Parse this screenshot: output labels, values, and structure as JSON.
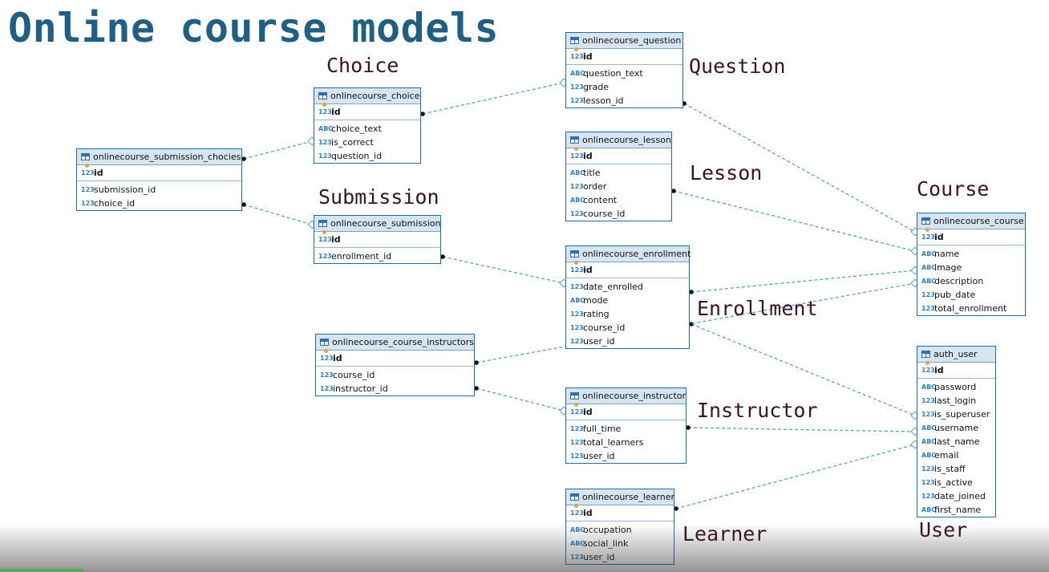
{
  "title": "Online course models",
  "model_labels": {
    "choice": "Choice",
    "question": "Question",
    "lesson": "Lesson",
    "course": "Course",
    "submission": "Submission",
    "enrollment": "Enrollment",
    "instructor": "Instructor",
    "learner": "Learner",
    "user": "User"
  },
  "type_icons": {
    "numeric": "123",
    "text": "ABC"
  },
  "colors": {
    "title": "#1f5f86",
    "entity_border": "#1e6ea2",
    "link": "#5a9fd0",
    "model_label": "#3b1420"
  },
  "entities": {
    "question": {
      "name": "onlinecourse_question",
      "pk": "id",
      "fields": [
        {
          "type": "ABC",
          "name": "question_text"
        },
        {
          "type": "123",
          "name": "grade"
        },
        {
          "type": "123",
          "name": "lesson_id"
        }
      ]
    },
    "choice": {
      "name": "onlinecourse_choice",
      "pk": "id",
      "fields": [
        {
          "type": "ABC",
          "name": "choice_text"
        },
        {
          "type": "123",
          "name": "is_correct"
        },
        {
          "type": "123",
          "name": "question_id"
        }
      ]
    },
    "submission_choices": {
      "name": "onlinecourse_submission_chocies",
      "pk": "id",
      "fields": [
        {
          "type": "123",
          "name": "submission_id"
        },
        {
          "type": "123",
          "name": "choice_id"
        }
      ]
    },
    "lesson": {
      "name": "onlinecourse_lesson",
      "pk": "id",
      "fields": [
        {
          "type": "ABC",
          "name": "title"
        },
        {
          "type": "123",
          "name": "order"
        },
        {
          "type": "ABC",
          "name": "content"
        },
        {
          "type": "123",
          "name": "course_id"
        }
      ]
    },
    "submission": {
      "name": "onlinecourse_submission",
      "pk": "id",
      "fields": [
        {
          "type": "123",
          "name": "enrollment_id"
        }
      ]
    },
    "enrollment": {
      "name": "onlinecourse_enrollment",
      "pk": "id",
      "fields": [
        {
          "type": "123",
          "name": "date_enrolled"
        },
        {
          "type": "ABC",
          "name": "mode"
        },
        {
          "type": "123",
          "name": "rating"
        },
        {
          "type": "123",
          "name": "course_id"
        },
        {
          "type": "123",
          "name": "user_id"
        }
      ]
    },
    "course": {
      "name": "onlinecourse_course",
      "pk": "id",
      "fields": [
        {
          "type": "ABC",
          "name": "name"
        },
        {
          "type": "ABC",
          "name": "image"
        },
        {
          "type": "ABC",
          "name": "description"
        },
        {
          "type": "123",
          "name": "pub_date"
        },
        {
          "type": "123",
          "name": "total_enrollment"
        }
      ]
    },
    "course_instructors": {
      "name": "onlinecourse_course_instructors",
      "pk": "id",
      "fields": [
        {
          "type": "123",
          "name": "course_id"
        },
        {
          "type": "123",
          "name": "instructor_id"
        }
      ]
    },
    "instructor": {
      "name": "onlinecourse_instructor",
      "pk": "id",
      "fields": [
        {
          "type": "123",
          "name": "full_time"
        },
        {
          "type": "123",
          "name": "total_learners"
        },
        {
          "type": "123",
          "name": "user_id"
        }
      ]
    },
    "learner": {
      "name": "onlinecourse_learner",
      "pk": "id",
      "fields": [
        {
          "type": "ABC",
          "name": "occupation"
        },
        {
          "type": "ABC",
          "name": "social_link"
        },
        {
          "type": "123",
          "name": "user_id"
        }
      ]
    },
    "auth_user": {
      "name": "auth_user",
      "pk": "id",
      "fields": [
        {
          "type": "ABC",
          "name": "password"
        },
        {
          "type": "123",
          "name": "last_login"
        },
        {
          "type": "123",
          "name": "is_superuser"
        },
        {
          "type": "ABC",
          "name": "username"
        },
        {
          "type": "ABC",
          "name": "last_name"
        },
        {
          "type": "ABC",
          "name": "email"
        },
        {
          "type": "123",
          "name": "is_staff"
        },
        {
          "type": "123",
          "name": "is_active"
        },
        {
          "type": "123",
          "name": "date_joined"
        },
        {
          "type": "ABC",
          "name": "first_name"
        }
      ]
    }
  },
  "relationships": [
    {
      "from": "choice",
      "to": "question"
    },
    {
      "from": "submission_choices",
      "to": "choice"
    },
    {
      "from": "submission_choices",
      "to": "submission"
    },
    {
      "from": "submission",
      "to": "enrollment"
    },
    {
      "from": "question",
      "to": "course"
    },
    {
      "from": "lesson",
      "to": "course"
    },
    {
      "from": "enrollment",
      "to": "course"
    },
    {
      "from": "enrollment",
      "to": "auth_user"
    },
    {
      "from": "course_instructors",
      "to": "course"
    },
    {
      "from": "course_instructors",
      "to": "instructor"
    },
    {
      "from": "instructor",
      "to": "auth_user"
    },
    {
      "from": "learner",
      "to": "auth_user"
    }
  ]
}
